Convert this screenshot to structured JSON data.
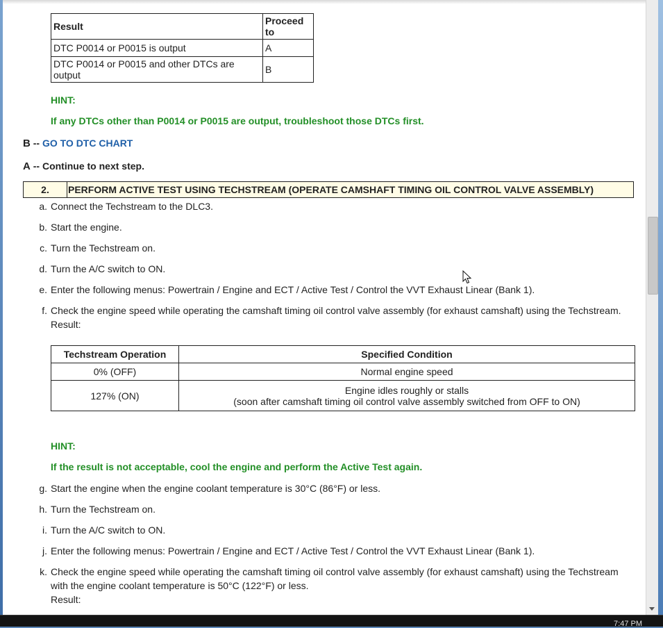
{
  "table1": {
    "headers": [
      "Result",
      "Proceed to"
    ],
    "rows": [
      [
        "DTC P0014 or P0015 is output",
        "A"
      ],
      [
        "DTC P0014 or P0015 and other DTCs are output",
        "B"
      ]
    ]
  },
  "hint1": {
    "label": "HINT:",
    "text": "If any DTCs other than P0014 or P0015 are output, troubleshoot those DTCs first."
  },
  "result_b": {
    "letter": "B",
    "dash": "--",
    "link": "GO TO DTC CHART"
  },
  "result_a": {
    "letter": "A",
    "dash": "--",
    "text": "Continue to next step."
  },
  "step2": {
    "number": "2.",
    "title": "PERFORM ACTIVE TEST USING TECHSTREAM (OPERATE CAMSHAFT TIMING OIL CONTROL VALVE ASSEMBLY)"
  },
  "steps_a_f": [
    {
      "marker": "a.",
      "text": "Connect the Techstream to the DLC3."
    },
    {
      "marker": "b.",
      "text": "Start the engine."
    },
    {
      "marker": "c.",
      "text": "Turn the Techstream on."
    },
    {
      "marker": "d.",
      "text": "Turn the A/C switch to ON."
    },
    {
      "marker": "e.",
      "text": "Enter the following menus: Powertrain / Engine and ECT / Active Test / Control the VVT Exhaust Linear (Bank 1)."
    },
    {
      "marker": "f.",
      "text": "Check the engine speed while operating the camshaft timing oil control valve assembly (for exhaust camshaft) using the Techstream.",
      "sub": "Result:"
    }
  ],
  "table2": {
    "headers": [
      "Techstream Operation",
      "Specified Condition"
    ],
    "rows": [
      {
        "op": "0% (OFF)",
        "cond": "Normal engine speed",
        "cond2": ""
      },
      {
        "op": "127% (ON)",
        "cond": "Engine idles roughly or stalls",
        "cond2": "(soon after camshaft timing oil control valve assembly switched from OFF to ON)"
      }
    ]
  },
  "hint2": {
    "label": "HINT:",
    "text": "If the result is not acceptable, cool the engine and perform the Active Test again."
  },
  "steps_g_k": [
    {
      "marker": "g.",
      "text": "Start the engine when the engine coolant temperature is 30°C (86°F) or less."
    },
    {
      "marker": "h.",
      "text": "Turn the Techstream on."
    },
    {
      "marker": "i.",
      "text": "Turn the A/C switch to ON."
    },
    {
      "marker": "j.",
      "text": "Enter the following menus: Powertrain / Engine and ECT / Active Test / Control the VVT Exhaust Linear (Bank 1)."
    },
    {
      "marker": "k.",
      "text": "Check the engine speed while operating the camshaft timing oil control valve assembly (for exhaust camshaft) using the Techstream",
      "line2": "with the engine coolant temperature is 50°C (122°F) or less.",
      "sub": "Result:"
    }
  ],
  "taskbar": {
    "clock": "7:47 PM"
  },
  "colors": {
    "hint_green": "#238f27",
    "link_blue": "#1f5fa8",
    "step_bg": "#fffce6"
  }
}
